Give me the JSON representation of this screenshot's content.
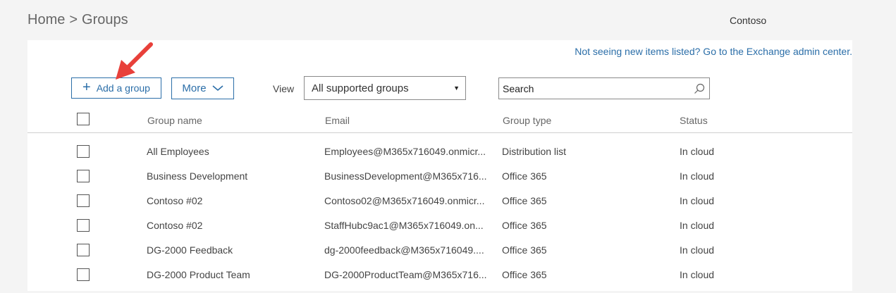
{
  "breadcrumb": {
    "home": "Home",
    "separator": ">",
    "current": "Groups"
  },
  "tenant": "Contoso",
  "exchange_link": "Not seeing new items listed? Go to the Exchange admin center.",
  "toolbar": {
    "add_label": "Add a group",
    "more_label": "More",
    "view_label": "View",
    "view_value": "All supported groups",
    "search_placeholder": "Search"
  },
  "table": {
    "columns": [
      "Group name",
      "Email",
      "Group type",
      "Status"
    ],
    "rows": [
      {
        "name": "All Employees",
        "email": "Employees@M365x716049.onmicr...",
        "type": "Distribution list",
        "status": "In cloud"
      },
      {
        "name": "Business Development",
        "email": "BusinessDevelopment@M365x716...",
        "type": "Office 365",
        "status": "In cloud"
      },
      {
        "name": "Contoso #02",
        "email": "Contoso02@M365x716049.onmicr...",
        "type": "Office 365",
        "status": "In cloud"
      },
      {
        "name": "Contoso #02",
        "email": "StaffHubc9ac1@M365x716049.on...",
        "type": "Office 365",
        "status": "In cloud"
      },
      {
        "name": "DG-2000 Feedback",
        "email": "dg-2000feedback@M365x716049....",
        "type": "Office 365",
        "status": "In cloud"
      },
      {
        "name": "DG-2000 Product Team",
        "email": "DG-2000ProductTeam@M365x716...",
        "type": "Office 365",
        "status": "In cloud"
      }
    ]
  },
  "colors": {
    "accent": "#2b6ea8",
    "annotation_arrow": "#e8403a"
  },
  "icons": {
    "add": "plus-icon",
    "more": "chevron-down-icon",
    "view": "caret-down-icon",
    "search": "search-icon"
  }
}
